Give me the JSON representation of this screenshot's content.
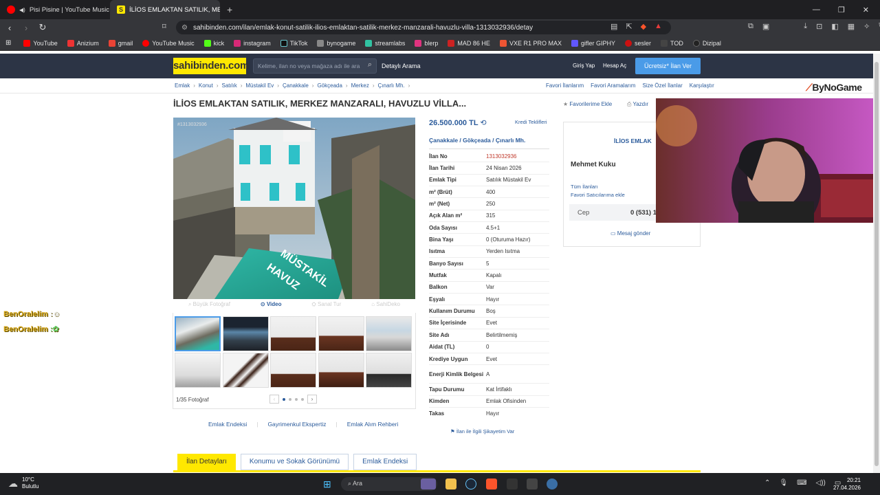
{
  "browser": {
    "tabs": [
      {
        "title": "Pisi Pisine | YouTube Music",
        "active": false
      },
      {
        "title": "İLİOS EMLAKTAN SATILIK, MERK",
        "active": true
      }
    ],
    "url": "sahibinden.com/ilan/emlak-konut-satilik-ilios-emlaktan-satilik-merkez-manzarali-havuzlu-villa-1313032936/detay",
    "bookmarks": [
      "YouTube",
      "Anizium",
      "gmail",
      "YouTube Music",
      "kick",
      "instagram",
      "TikTok",
      "bynogame",
      "streamlabs",
      "blerp",
      "MAD 86 HE",
      "VXE R1 PRO MAX",
      "gifler GIPHY",
      "sesler",
      "TOD",
      "Dizipal"
    ]
  },
  "site": {
    "logo": "sahibinden.com",
    "search_placeholder": "Kelime, ilan no veya mağaza adı ile ara",
    "detailed_search": "Detaylı Arama",
    "login": "Giriş Yap",
    "register": "Hesap Aç",
    "post_ad": "Ücretsiz* İlan Ver",
    "breadcrumbs": [
      "Emlak",
      "Konut",
      "Satılık",
      "Müstakil Ev",
      "Çanakkale",
      "Gökçeada",
      "Merkez",
      "Çınarlı Mh."
    ],
    "top_links": [
      "Favori İlanlarım",
      "Favori Aramalarım",
      "Size Özel İlanlar",
      "Karşılaştır"
    ],
    "watermark_logo": "ByNoGame"
  },
  "listing": {
    "title": "İLİOS EMLAKTAN SATILIK, MERKEZ MANZARALI, HAVUZLU VİLLA...",
    "add_favorite": "Favorilerime Ekle",
    "print": "Yazdır",
    "photo_id": "#1313032936",
    "photo_overlay_text": "MÜSTAKİL HAVUZ",
    "photo_tools": [
      "Büyük Fotoğraf",
      "Video",
      "Sanal Tur",
      "SahiDeko"
    ],
    "photo_count": "1/35 Fotoğraf",
    "price": "26.500.000 TL",
    "credit_offers": "Kredi Teklifleri",
    "location": [
      "Çanakkale",
      "Gökçeada",
      "Çınarlı Mh."
    ],
    "attributes": [
      {
        "k": "İlan No",
        "v": "1313032936"
      },
      {
        "k": "İlan Tarihi",
        "v": "24 Nisan 2026"
      },
      {
        "k": "Emlak Tipi",
        "v": "Satılık Müstakil Ev"
      },
      {
        "k": "m² (Brüt)",
        "v": "400"
      },
      {
        "k": "m² (Net)",
        "v": "250"
      },
      {
        "k": "Açık Alan m²",
        "v": "315"
      },
      {
        "k": "Oda Sayısı",
        "v": "4.5+1"
      },
      {
        "k": "Bina Yaşı",
        "v": "0 (Oturuma Hazır)"
      },
      {
        "k": "Isıtma",
        "v": "Yerden Isıtma"
      },
      {
        "k": "Banyo Sayısı",
        "v": "5"
      },
      {
        "k": "Mutfak",
        "v": "Kapalı"
      },
      {
        "k": "Balkon",
        "v": "Var"
      },
      {
        "k": "Eşyalı",
        "v": "Hayır"
      },
      {
        "k": "Kullanım Durumu",
        "v": "Boş"
      },
      {
        "k": "Site İçerisinde",
        "v": "Evet"
      },
      {
        "k": "Site Adı",
        "v": "Belirtilmemiş"
      },
      {
        "k": "Aidat (TL)",
        "v": "0"
      },
      {
        "k": "Krediye Uygun",
        "v": "Evet"
      },
      {
        "k": "Enerji Kimlik Belgesi",
        "v": "A"
      },
      {
        "k": "Tapu Durumu",
        "v": "Kat İrtifaklı"
      },
      {
        "k": "Kimden",
        "v": "Emlak Ofisinden"
      },
      {
        "k": "Takas",
        "v": "Hayır"
      }
    ],
    "complaint": "İlan ile İlgili Şikayetim Var",
    "bottom_links": [
      "Emlak Endeksi",
      "Gayrimenkul Ekspertiz",
      "Emlak Alım Rehberi"
    ],
    "bottom_tabs": [
      "İlan Detayları",
      "Konumu ve Sokak Görünümü",
      "Emlak Endeksi"
    ]
  },
  "seller": {
    "store": "İLİOS EMLAK",
    "name": "Mehmet Kuku",
    "all_ads": "Tüm İlanları",
    "fav_seller": "Favori Satıcılarıma ekle",
    "phone_label": "Cep",
    "phone": "0 (531) 1",
    "message": "Mesaj gönder"
  },
  "chat": [
    "BenOralelim",
    "BenOralelim"
  ],
  "taskbar": {
    "temp": "10°C",
    "weather": "Bulutlu",
    "search": "Ara",
    "time": "20:21",
    "date": "27.04.2026"
  }
}
